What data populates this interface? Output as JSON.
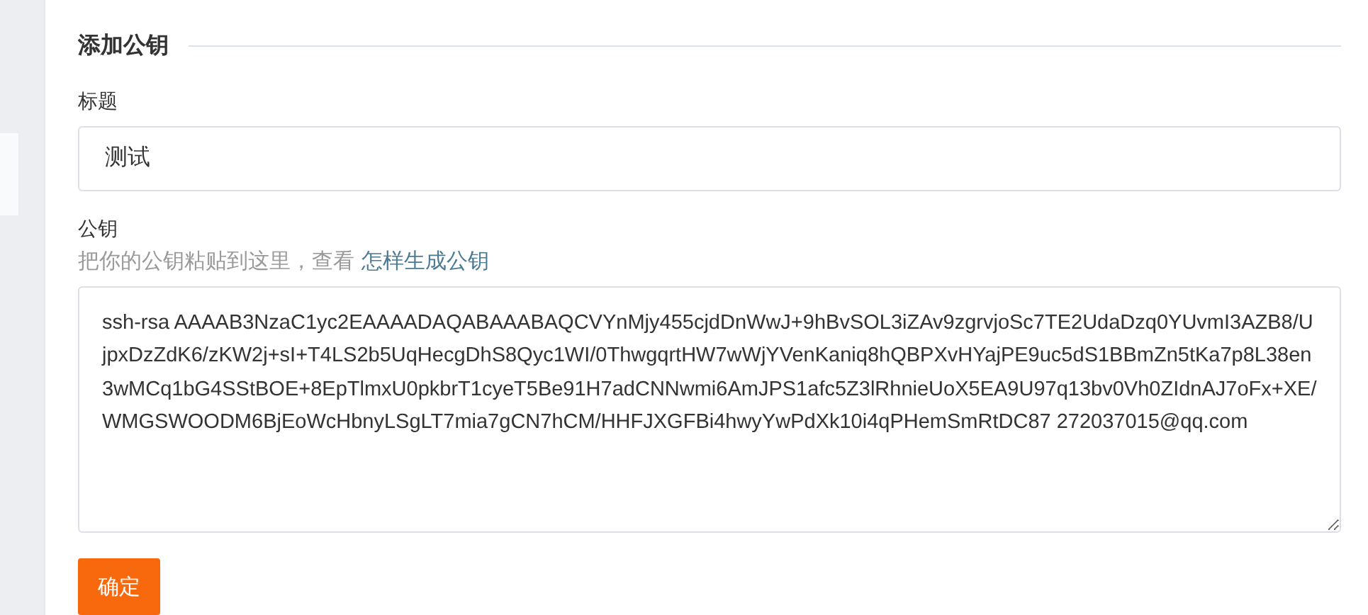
{
  "section_title": "添加公钥",
  "title_field": {
    "label": "标题",
    "value": "测试"
  },
  "key_field": {
    "label": "公钥",
    "hint": "把你的公钥粘贴到这里，查看",
    "hint_link": "怎样生成公钥",
    "value": "ssh-rsa AAAAB3NzaC1yc2EAAAADAQABAAABAQCVYnMjy455cjdDnWwJ+9hBvSOL3iZAv9zgrvjoSc7TE2UdaDzq0YUvmI3AZB8/UjpxDzZdK6/zKW2j+sI+T4LS2b5UqHecgDhS8Qyc1WI/0ThwgqrtHW7wWjYVenKaniq8hQBPXvHYajPE9uc5dS1BBmZn5tKa7p8L38en3wMCq1bG4SStBOE+8EpTlmxU0pkbrT1cyeT5Be91H7adCNNwmi6AmJPS1afc5Z3lRhnieUoX5EA9U97q13bv0Vh0ZIdnAJ7oFx+XE/WMGSWOODM6BjEoWcHbnyLSgLT7mia7gCN7hCM/HHFJXGFBi4hwyYwPdXk10i4qPHemSmRtDC87 272037015@qq.com"
  },
  "submit_button": "确定"
}
